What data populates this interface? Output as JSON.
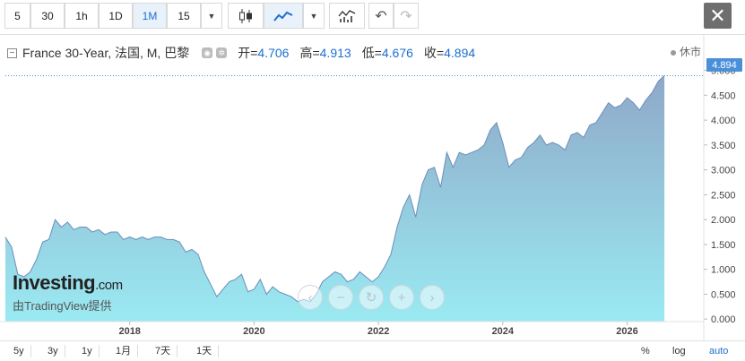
{
  "toolbar": {
    "intervals": [
      "5",
      "30",
      "1h",
      "1D",
      "1M",
      "15"
    ],
    "active_interval": "1M",
    "dropdown_icon": "chevron-down-icon",
    "close_label": "✕"
  },
  "legend": {
    "title": "France 30-Year, 法国, M, 巴黎",
    "open_label": "开=",
    "open_value": "4.706",
    "high_label": "高=",
    "high_value": "4.913",
    "low_label": "低=",
    "low_value": "4.676",
    "close_label": "收=",
    "close_value": "4.894"
  },
  "market_status": "休市",
  "last_price": "4.894",
  "watermark": {
    "brand": "Investing",
    "dotcom": ".com",
    "provided_by": "由TradingView提供"
  },
  "bottom": {
    "ranges": [
      "5y",
      "3y",
      "1y",
      "1月",
      "7天",
      "1天"
    ],
    "percent": "%",
    "log": "log",
    "auto": "auto"
  },
  "colors": {
    "accent": "#1b6fd1",
    "area_top": "#8fa8c8",
    "area_bottom": "#9aeaf2",
    "line": "#6b8fb8"
  },
  "chart_data": {
    "type": "area",
    "title": "France 30-Year",
    "x_ticks": [
      "2018",
      "2020",
      "2022",
      "2024",
      "2026"
    ],
    "y_ticks": [
      "0.000",
      "0.500",
      "1.000",
      "1.500",
      "2.000",
      "2.500",
      "3.000",
      "3.500",
      "4.000",
      "4.500",
      "5.000"
    ],
    "ylim": [
      -0.05,
      5.1
    ],
    "xlim": [
      2016.0,
      2026.8
    ],
    "x": [
      2016.0,
      2016.1,
      2016.2,
      2016.3,
      2016.4,
      2016.5,
      2016.6,
      2016.7,
      2016.8,
      2016.9,
      2017.0,
      2017.1,
      2017.2,
      2017.3,
      2017.4,
      2017.5,
      2017.6,
      2017.7,
      2017.8,
      2017.9,
      2018.0,
      2018.1,
      2018.2,
      2018.3,
      2018.4,
      2018.5,
      2018.6,
      2018.7,
      2018.8,
      2018.9,
      2019.0,
      2019.1,
      2019.2,
      2019.3,
      2019.4,
      2019.5,
      2019.6,
      2019.7,
      2019.8,
      2019.9,
      2020.0,
      2020.1,
      2020.2,
      2020.3,
      2020.4,
      2020.5,
      2020.6,
      2020.7,
      2020.8,
      2020.9,
      2021.0,
      2021.1,
      2021.2,
      2021.3,
      2021.4,
      2021.5,
      2021.6,
      2021.7,
      2021.8,
      2021.9,
      2022.0,
      2022.1,
      2022.2,
      2022.3,
      2022.4,
      2022.5,
      2022.6,
      2022.7,
      2022.8,
      2022.9,
      2023.0,
      2023.1,
      2023.2,
      2023.3,
      2023.4,
      2023.5,
      2023.6,
      2023.7,
      2023.8,
      2023.9,
      2024.0,
      2024.1,
      2024.2,
      2024.3,
      2024.4,
      2024.5,
      2024.6,
      2024.7,
      2024.8,
      2024.9,
      2025.0,
      2025.1,
      2025.2,
      2025.3,
      2025.4,
      2025.5,
      2025.6,
      2025.7,
      2025.8,
      2025.9,
      2026.0,
      2026.1,
      2026.2,
      2026.3,
      2026.4,
      2026.5,
      2026.6
    ],
    "values": [
      1.65,
      1.45,
      0.9,
      0.85,
      0.95,
      1.2,
      1.55,
      1.6,
      2.0,
      1.85,
      1.95,
      1.8,
      1.85,
      1.85,
      1.75,
      1.8,
      1.7,
      1.75,
      1.75,
      1.6,
      1.65,
      1.6,
      1.65,
      1.6,
      1.65,
      1.65,
      1.6,
      1.6,
      1.55,
      1.35,
      1.4,
      1.3,
      0.95,
      0.7,
      0.45,
      0.6,
      0.75,
      0.8,
      0.9,
      0.55,
      0.6,
      0.8,
      0.5,
      0.65,
      0.55,
      0.5,
      0.45,
      0.35,
      0.4,
      0.35,
      0.5,
      0.75,
      0.85,
      0.95,
      0.9,
      0.75,
      0.8,
      0.95,
      0.85,
      0.75,
      0.85,
      1.05,
      1.3,
      1.85,
      2.25,
      2.5,
      2.05,
      2.7,
      3.0,
      3.05,
      2.65,
      3.35,
      3.05,
      3.35,
      3.3,
      3.35,
      3.4,
      3.5,
      3.8,
      3.95,
      3.55,
      3.05,
      3.2,
      3.25,
      3.45,
      3.55,
      3.7,
      3.5,
      3.55,
      3.5,
      3.4,
      3.7,
      3.75,
      3.65,
      3.9,
      3.95,
      4.15,
      4.35,
      4.25,
      4.3,
      4.45,
      4.35,
      4.2,
      4.4,
      4.55,
      4.78,
      4.894
    ]
  }
}
